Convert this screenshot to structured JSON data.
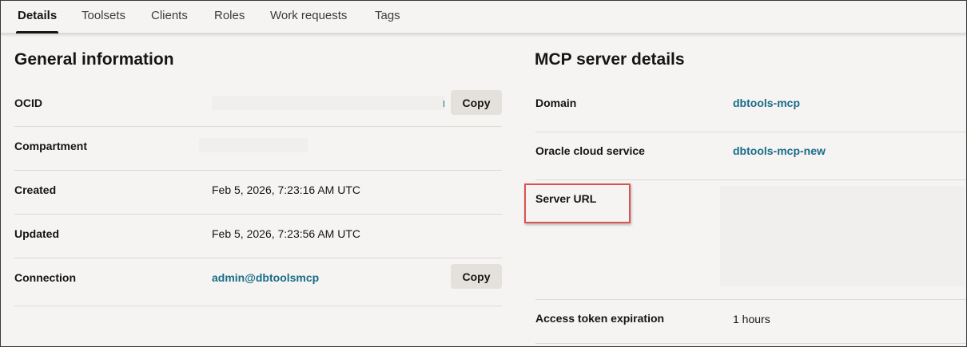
{
  "tabs": [
    {
      "label": "Details"
    },
    {
      "label": "Toolsets"
    },
    {
      "label": "Clients"
    },
    {
      "label": "Roles"
    },
    {
      "label": "Work requests"
    },
    {
      "label": "Tags"
    }
  ],
  "general": {
    "title": "General information",
    "copy_label": "Copy",
    "rows": [
      {
        "label": "OCID",
        "value": ""
      },
      {
        "label": "Compartment",
        "value": ""
      },
      {
        "label": "Created",
        "value": "Feb 5, 2026, 7:23:16 AM UTC"
      },
      {
        "label": "Updated",
        "value": "Feb 5, 2026, 7:23:56 AM UTC"
      },
      {
        "label": "Connection",
        "value": "admin@dbtoolsmcp"
      }
    ]
  },
  "mcp": {
    "title": "MCP server details",
    "rows": [
      {
        "label": "Domain",
        "value": "dbtools-mcp"
      },
      {
        "label": "Oracle cloud service",
        "value": "dbtools-mcp-new"
      },
      {
        "label": "Server URL",
        "value": ""
      },
      {
        "label": "Access token expiration",
        "value": "1 hours"
      }
    ]
  },
  "colors": {
    "link": "#1a6c89",
    "highlight": "#d9534f",
    "background": "#f5f4f2"
  }
}
